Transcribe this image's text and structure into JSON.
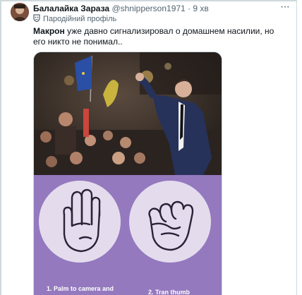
{
  "tweet": {
    "author": {
      "display_name": "Балалайка Зараза",
      "handle": "@shnipperson1971",
      "separator": "·",
      "time": "9 хв",
      "label": "Пародійний профіль"
    },
    "text_bold": "Макрон",
    "text_rest": " уже давно сигнализировал о домашнем насилии, но его никто не понимал..",
    "more_icon": "more-horizontal-icon"
  },
  "media": {
    "captions": [
      "1. Palm to camera and",
      "2. Tran thumb"
    ],
    "colors": {
      "panel": "#9479bf",
      "circle": "#e4dced",
      "outline": "#2b2238"
    }
  }
}
